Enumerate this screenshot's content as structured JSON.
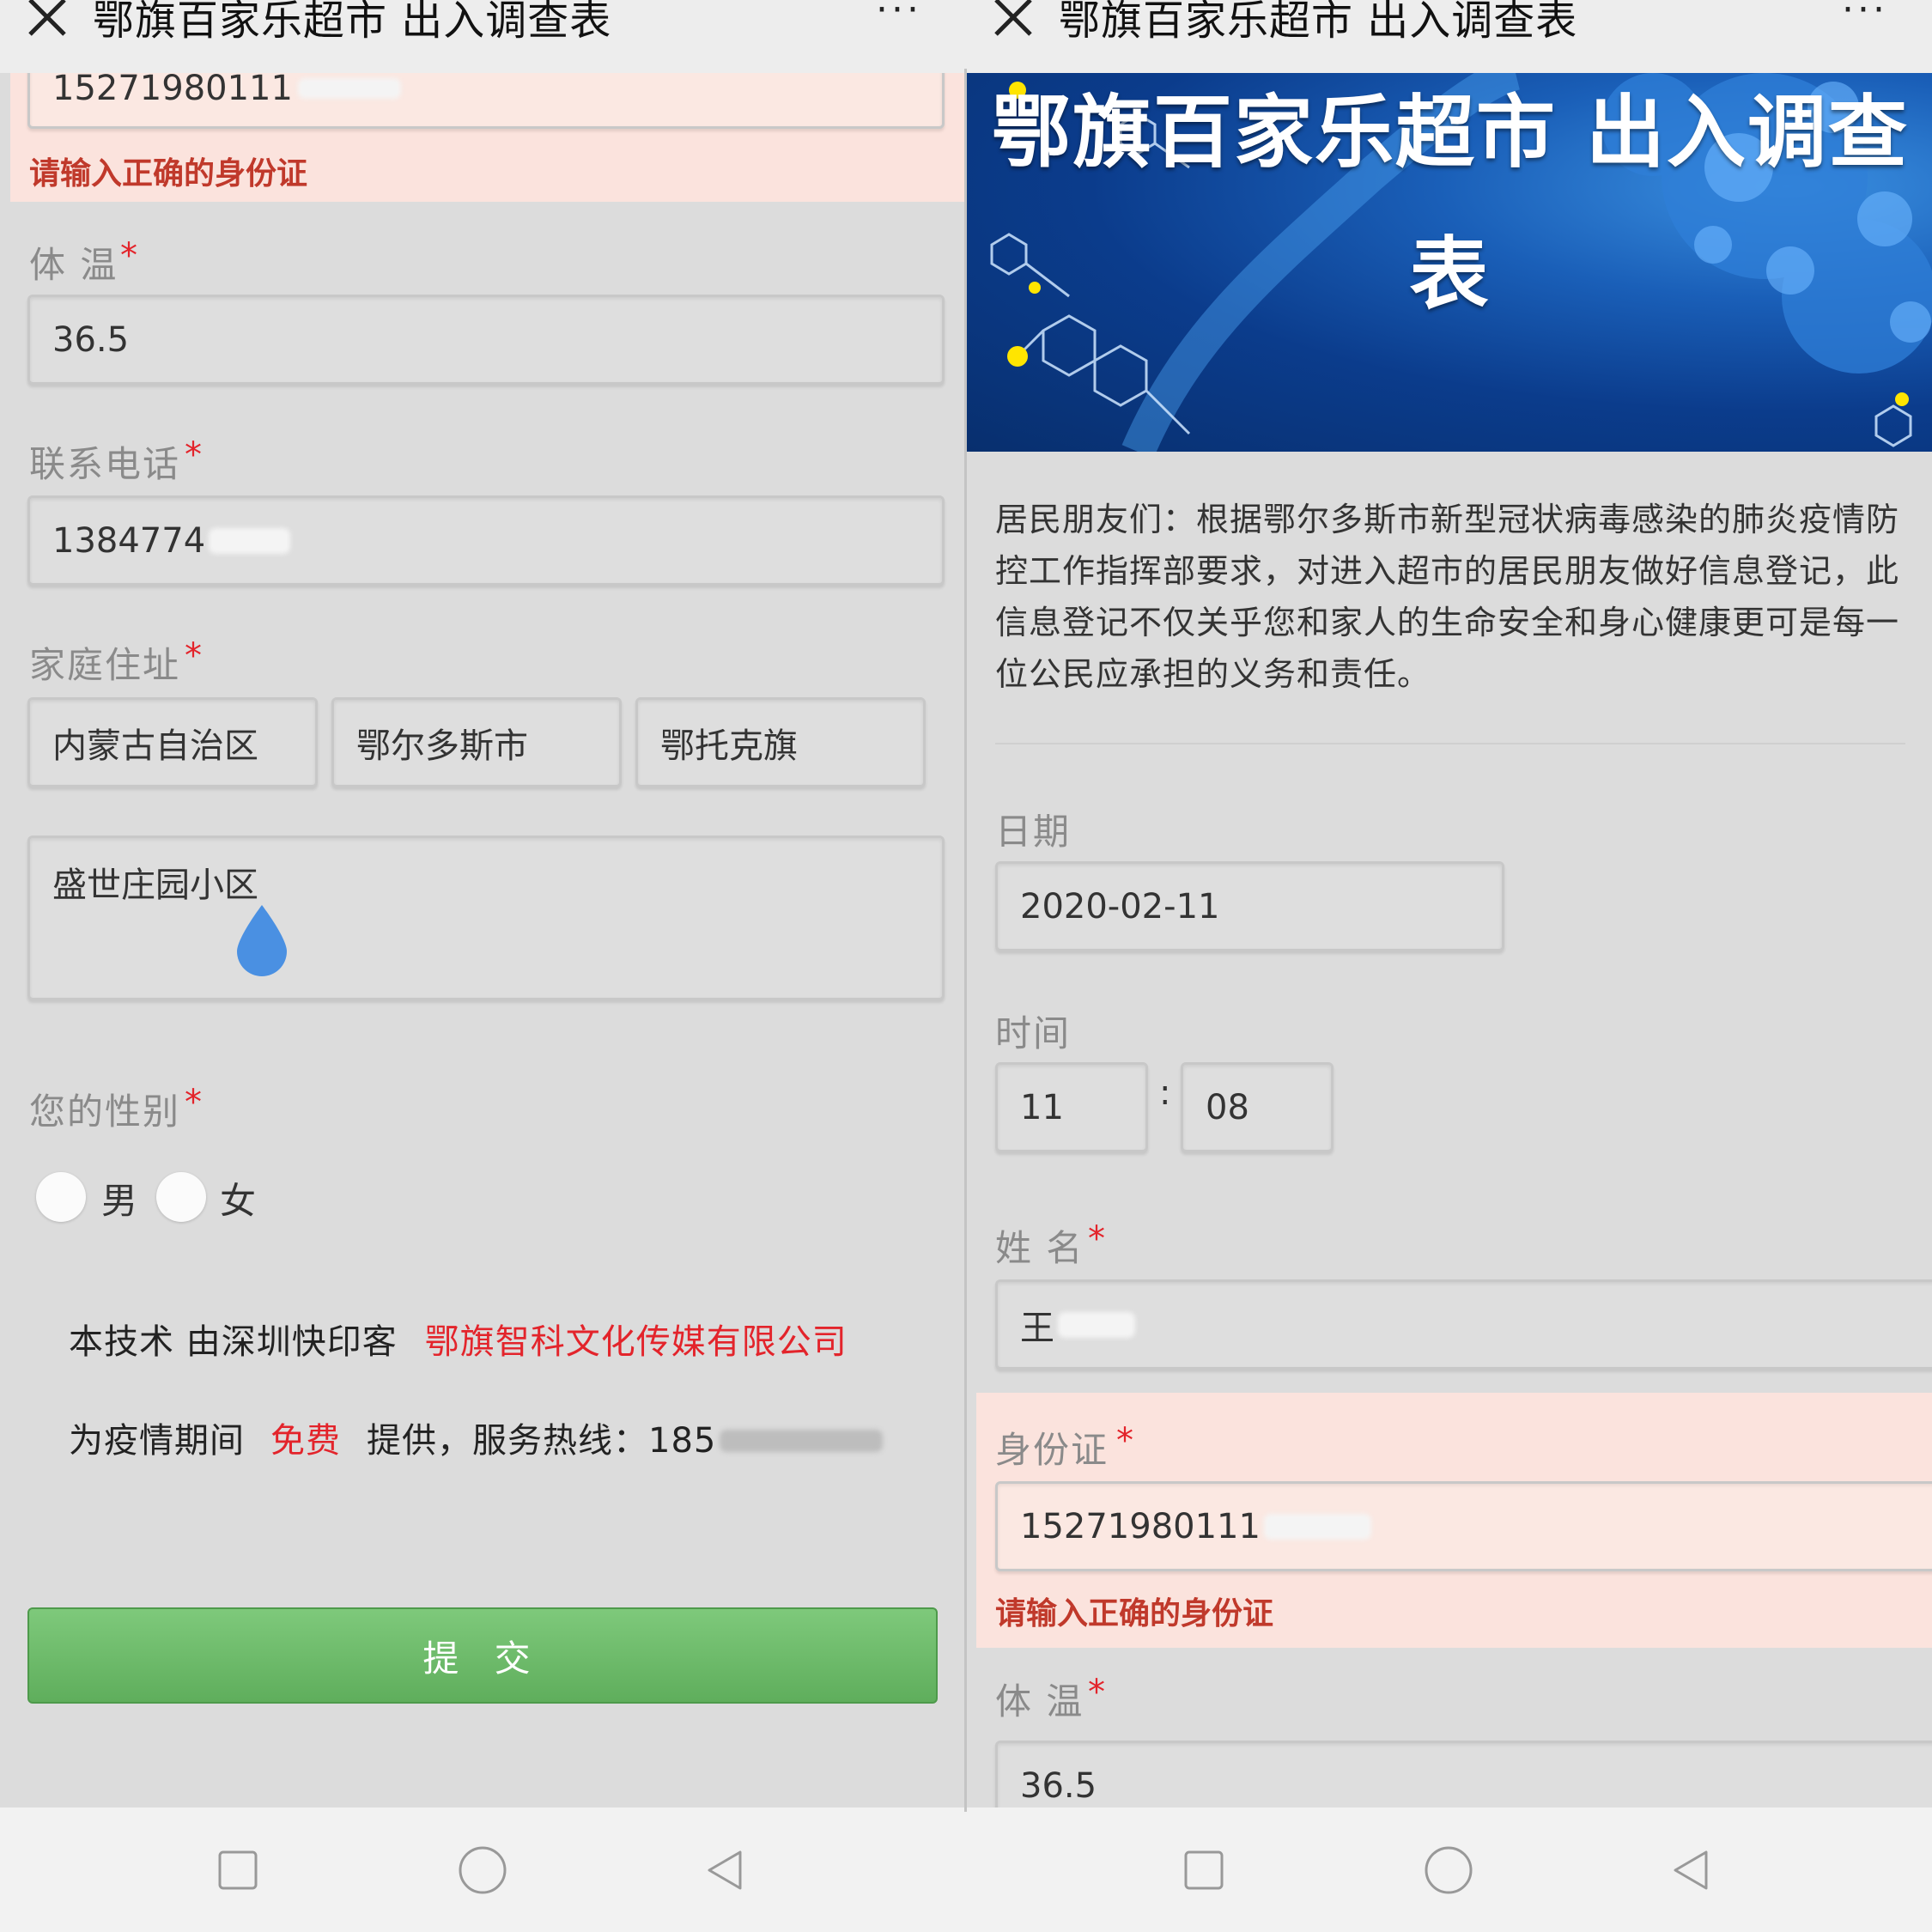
{
  "titlebar": {
    "title": "鄂旗百家乐超市 出入调查表",
    "more": "···"
  },
  "left": {
    "id_partial": "15271980111",
    "id_error": "请输入正确的身份证",
    "temperature": {
      "label": "体 温",
      "required": "*",
      "value": "36.5"
    },
    "phone": {
      "label": "联系电话",
      "required": "*",
      "value": "1384774"
    },
    "address": {
      "label": "家庭住址",
      "required": "*",
      "province": "内蒙古自治区",
      "city": "鄂尔多斯市",
      "district": "鄂托克旗",
      "detail": "盛世庄园小区"
    },
    "gender": {
      "label": "您的性别",
      "required": "*",
      "options": [
        "男",
        "女"
      ]
    },
    "footer": {
      "line1_prefix": "本技术 由深圳快印客",
      "line1_company": "鄂旗智科文化传媒有限公司",
      "line2_prefix": "为疫情期间",
      "line2_free": "免费",
      "line2_suffix": "提供，服务热线：185"
    },
    "submit_label": "提 交"
  },
  "right": {
    "banner_title_line1": "鄂旗百家乐超市 出入调查",
    "banner_title_line2": "表",
    "intro": "居民朋友们：根据鄂尔多斯市新型冠状病毒感染的肺炎疫情防控工作指挥部要求，对进入超市的居民朋友做好信息登记，此信息登记不仅关乎您和家人的生命安全和身心健康更可是每一位公民应承担的义务和责任。",
    "date": {
      "label": "日期",
      "value": "2020-02-11"
    },
    "time": {
      "label": "时间",
      "hour": "11",
      "sep": ":",
      "minute": "08"
    },
    "name": {
      "label": "姓 名",
      "required": "*",
      "value": "王"
    },
    "id_card": {
      "label": "身份证",
      "required": "*",
      "value": "15271980111",
      "error": "请输入正确的身份证"
    },
    "temperature": {
      "label": "体 温",
      "required": "*",
      "value": "36.5"
    }
  },
  "colors": {
    "accent_green": "#5fae5c",
    "error_red": "#e3242b",
    "error_bg": "#fbe3dd",
    "banner_blue": "#0b3c8c"
  },
  "icons": [
    "close-icon",
    "more-icon",
    "drop-cursor-icon",
    "nav-square-icon",
    "nav-circle-icon",
    "nav-back-icon"
  ]
}
